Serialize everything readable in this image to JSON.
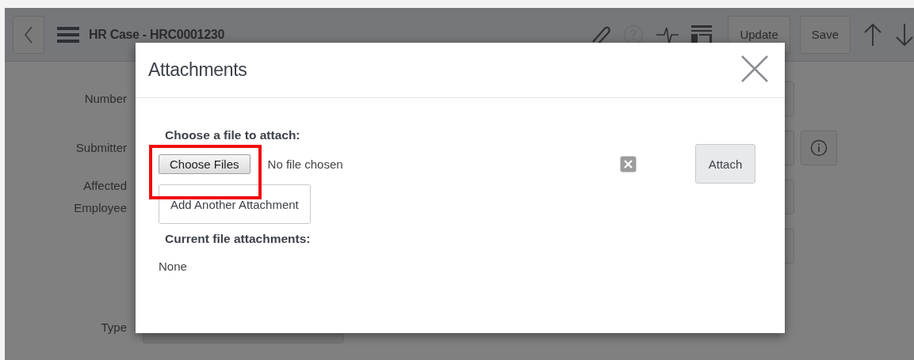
{
  "header": {
    "title": "HR Case - HRC0001230",
    "buttons": [
      "Update",
      "Save"
    ]
  },
  "form": {
    "fields": [
      {
        "label": "Number",
        "kind": "text"
      },
      {
        "label": "Submitter",
        "kind": "lookup"
      },
      {
        "label": "Affected Employee",
        "kind": "text"
      },
      {
        "kind": "text"
      },
      {
        "label": "Type",
        "kind": "select"
      }
    ]
  },
  "dialog": {
    "title": "Attachments",
    "prompt": "Choose a file to attach:",
    "choose_button": {
      "label": "Choose Files",
      "highlighted": true
    },
    "file_status": "No file chosen",
    "attach_button": "Attach",
    "add_button": "Add Another Attachment",
    "current_heading": "Current file attachments:",
    "current_value": "None"
  }
}
